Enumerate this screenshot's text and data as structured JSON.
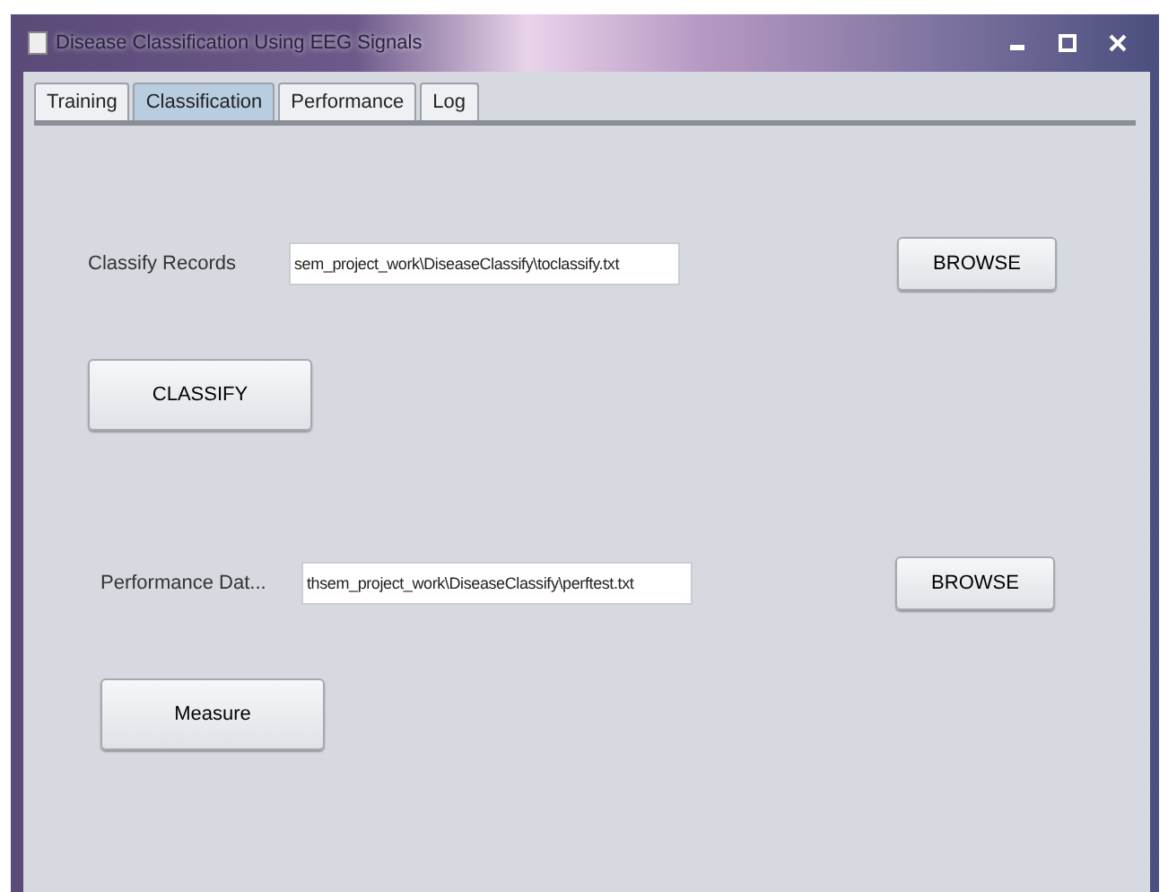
{
  "window": {
    "title": "Disease Classification Using EEG Signals"
  },
  "tabs": [
    {
      "label": "Training",
      "selected": false
    },
    {
      "label": "Classification",
      "selected": true
    },
    {
      "label": "Performance",
      "selected": false
    },
    {
      "label": "Log",
      "selected": false
    }
  ],
  "rows": [
    {
      "label": "Classify Records",
      "value": "sem_project_work\\DiseaseClassify\\toclassify.txt",
      "browse": "BROWSE",
      "action": "CLASSIFY"
    },
    {
      "label": "Performance Dat...",
      "value": "thsem_project_work\\DiseaseClassify\\perftest.txt",
      "browse": "BROWSE",
      "action": "Measure"
    }
  ]
}
